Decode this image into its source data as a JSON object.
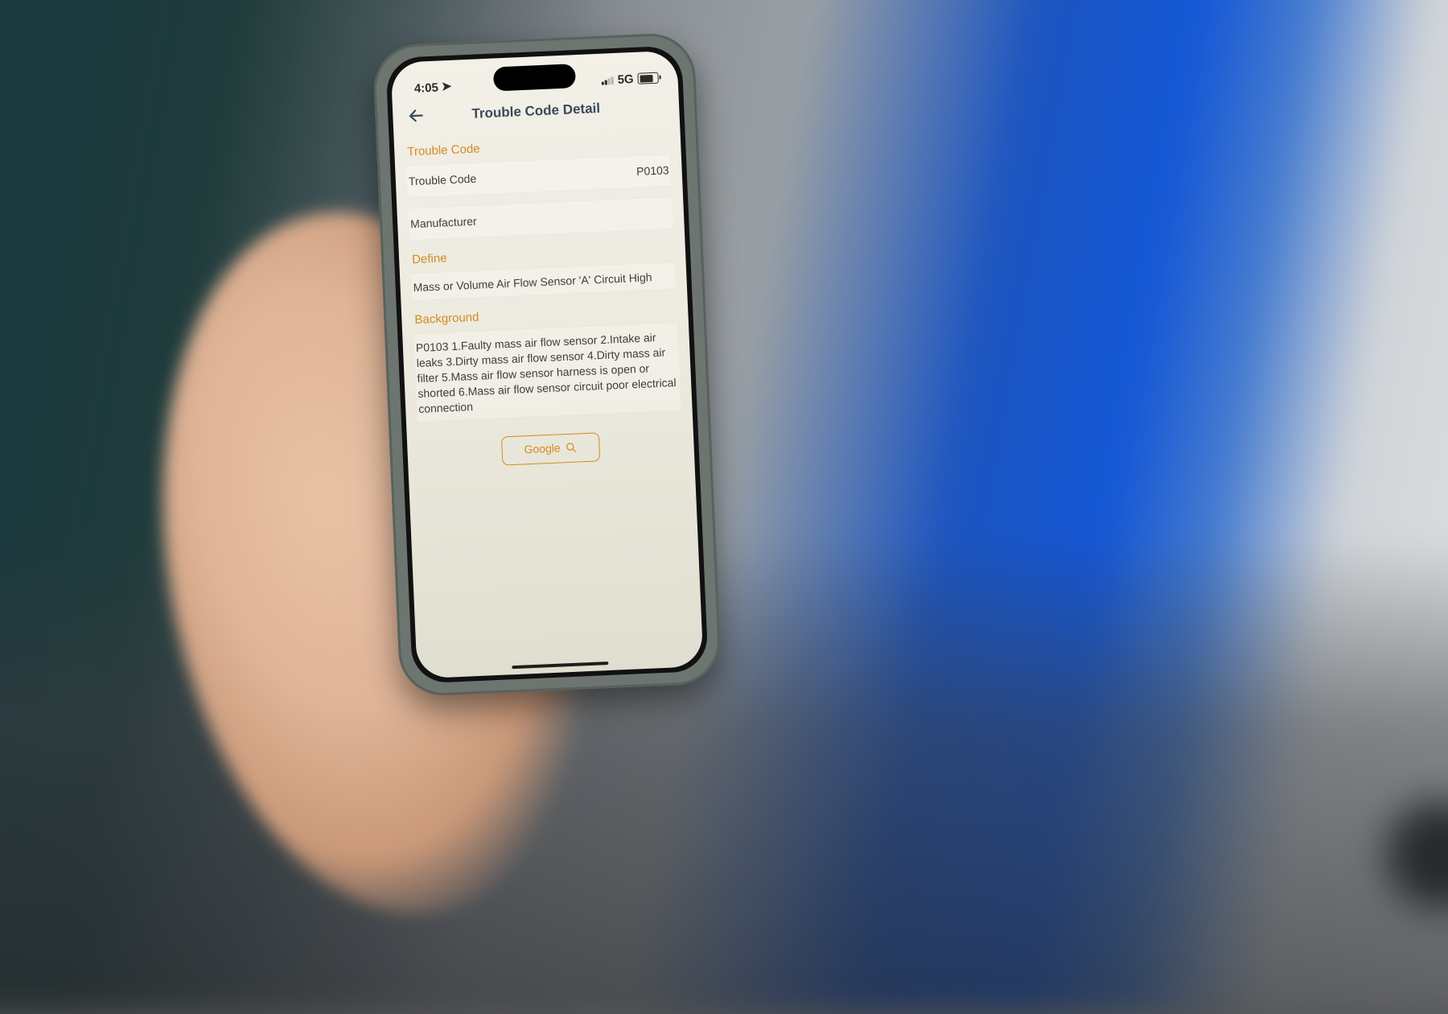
{
  "status": {
    "time": "4:05",
    "location_arrow": "➤",
    "network_label": "5G"
  },
  "header": {
    "title": "Trouble Code Detail"
  },
  "sections": {
    "trouble_code": {
      "label": "Trouble Code",
      "row_key": "Trouble Code",
      "row_value": "P0103",
      "manufacturer_key": "Manufacturer",
      "manufacturer_value": ""
    },
    "define": {
      "label": "Define",
      "text": "Mass or Volume Air Flow Sensor 'A' Circuit High"
    },
    "background": {
      "label": "Background",
      "text": "P0103 1.Faulty mass air flow sensor 2.Intake air leaks 3.Dirty mass air flow sensor 4.Dirty mass air filter 5.Mass air flow sensor harness is open or shorted 6.Mass air flow sensor circuit poor electrical connection"
    }
  },
  "google_button": {
    "label": "Google"
  }
}
